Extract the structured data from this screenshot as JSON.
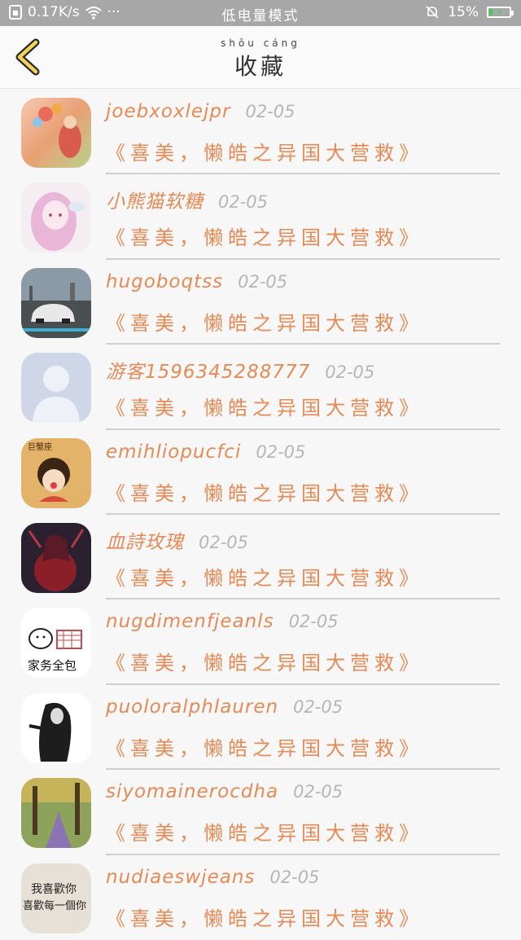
{
  "status_bar": {
    "speed": "0.17K/s",
    "dots": "···",
    "mode": "低电量模式",
    "battery": "15%",
    "battery_level": 0.15
  },
  "header": {
    "title_pinyin": "shōu cáng",
    "title": "收藏"
  },
  "items": [
    {
      "username": "joebxoxlejpr",
      "date": "02-05",
      "message": "《喜美，懒皓之异国大营救》"
    },
    {
      "username": "小熊猫软糖",
      "date": "02-05",
      "message": "《喜美，懒皓之异国大营救》"
    },
    {
      "username": "hugoboqtss",
      "date": "02-05",
      "message": "《喜美，懒皓之异国大营救》"
    },
    {
      "username": "游客1596345288777",
      "date": "02-05",
      "message": "《喜美，懒皓之异国大营救》"
    },
    {
      "username": "emihliopucfci",
      "date": "02-05",
      "message": "《喜美，懒皓之异国大营救》"
    },
    {
      "username": "血詩玫瑰",
      "date": "02-05",
      "message": "《喜美，懒皓之异国大营救》"
    },
    {
      "username": "nugdimenfjeanls",
      "date": "02-05",
      "message": "《喜美，懒皓之异国大营救》"
    },
    {
      "username": "puoloralphlauren",
      "date": "02-05",
      "message": "《喜美，懒皓之异国大营救》"
    },
    {
      "username": "siyomainerocdha",
      "date": "02-05",
      "message": "《喜美，懒皓之异国大营救》"
    },
    {
      "username": "nudiaeswjeans",
      "date": "02-05",
      "message": "《喜美，懒皓之异国大营救》"
    }
  ],
  "avatar_labels": {
    "a4": "巨蟹座",
    "a6": "家务全包",
    "a9_line1": "我喜歡你",
    "a9_line2": "喜歡每一個你"
  }
}
